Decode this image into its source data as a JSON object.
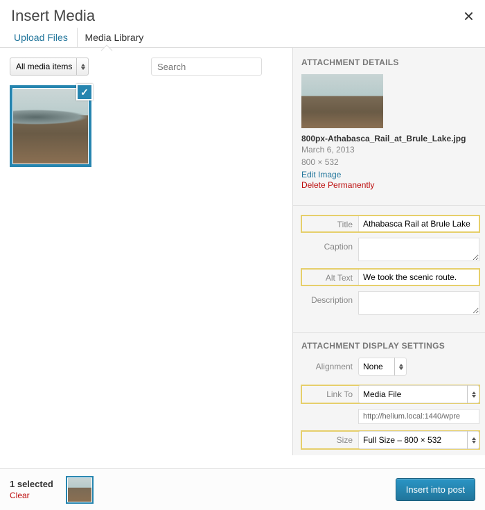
{
  "header": {
    "title": "Insert Media"
  },
  "tabs": {
    "upload": "Upload Files",
    "library": "Media Library"
  },
  "toolbar": {
    "filter": "All media items",
    "search_placeholder": "Search"
  },
  "details": {
    "heading": "ATTACHMENT DETAILS",
    "filename": "800px-Athabasca_Rail_at_Brule_Lake.jpg",
    "date": "March 6, 2013",
    "dimensions": "800 × 532",
    "edit": "Edit Image",
    "delete": "Delete Permanently",
    "fields": {
      "title_label": "Title",
      "title_value": "Athabasca Rail at Brule Lake",
      "caption_label": "Caption",
      "caption_value": "",
      "alt_label": "Alt Text",
      "alt_value": "We took the scenic route.",
      "desc_label": "Description",
      "desc_value": ""
    }
  },
  "display": {
    "heading": "ATTACHMENT DISPLAY SETTINGS",
    "alignment_label": "Alignment",
    "alignment_value": "None",
    "linkto_label": "Link To",
    "linkto_value": "Media File",
    "url": "http://helium.local:1440/wpre",
    "size_label": "Size",
    "size_value": "Full Size – 800 × 532"
  },
  "footer": {
    "selected": "1 selected",
    "clear": "Clear",
    "insert": "Insert into post"
  }
}
